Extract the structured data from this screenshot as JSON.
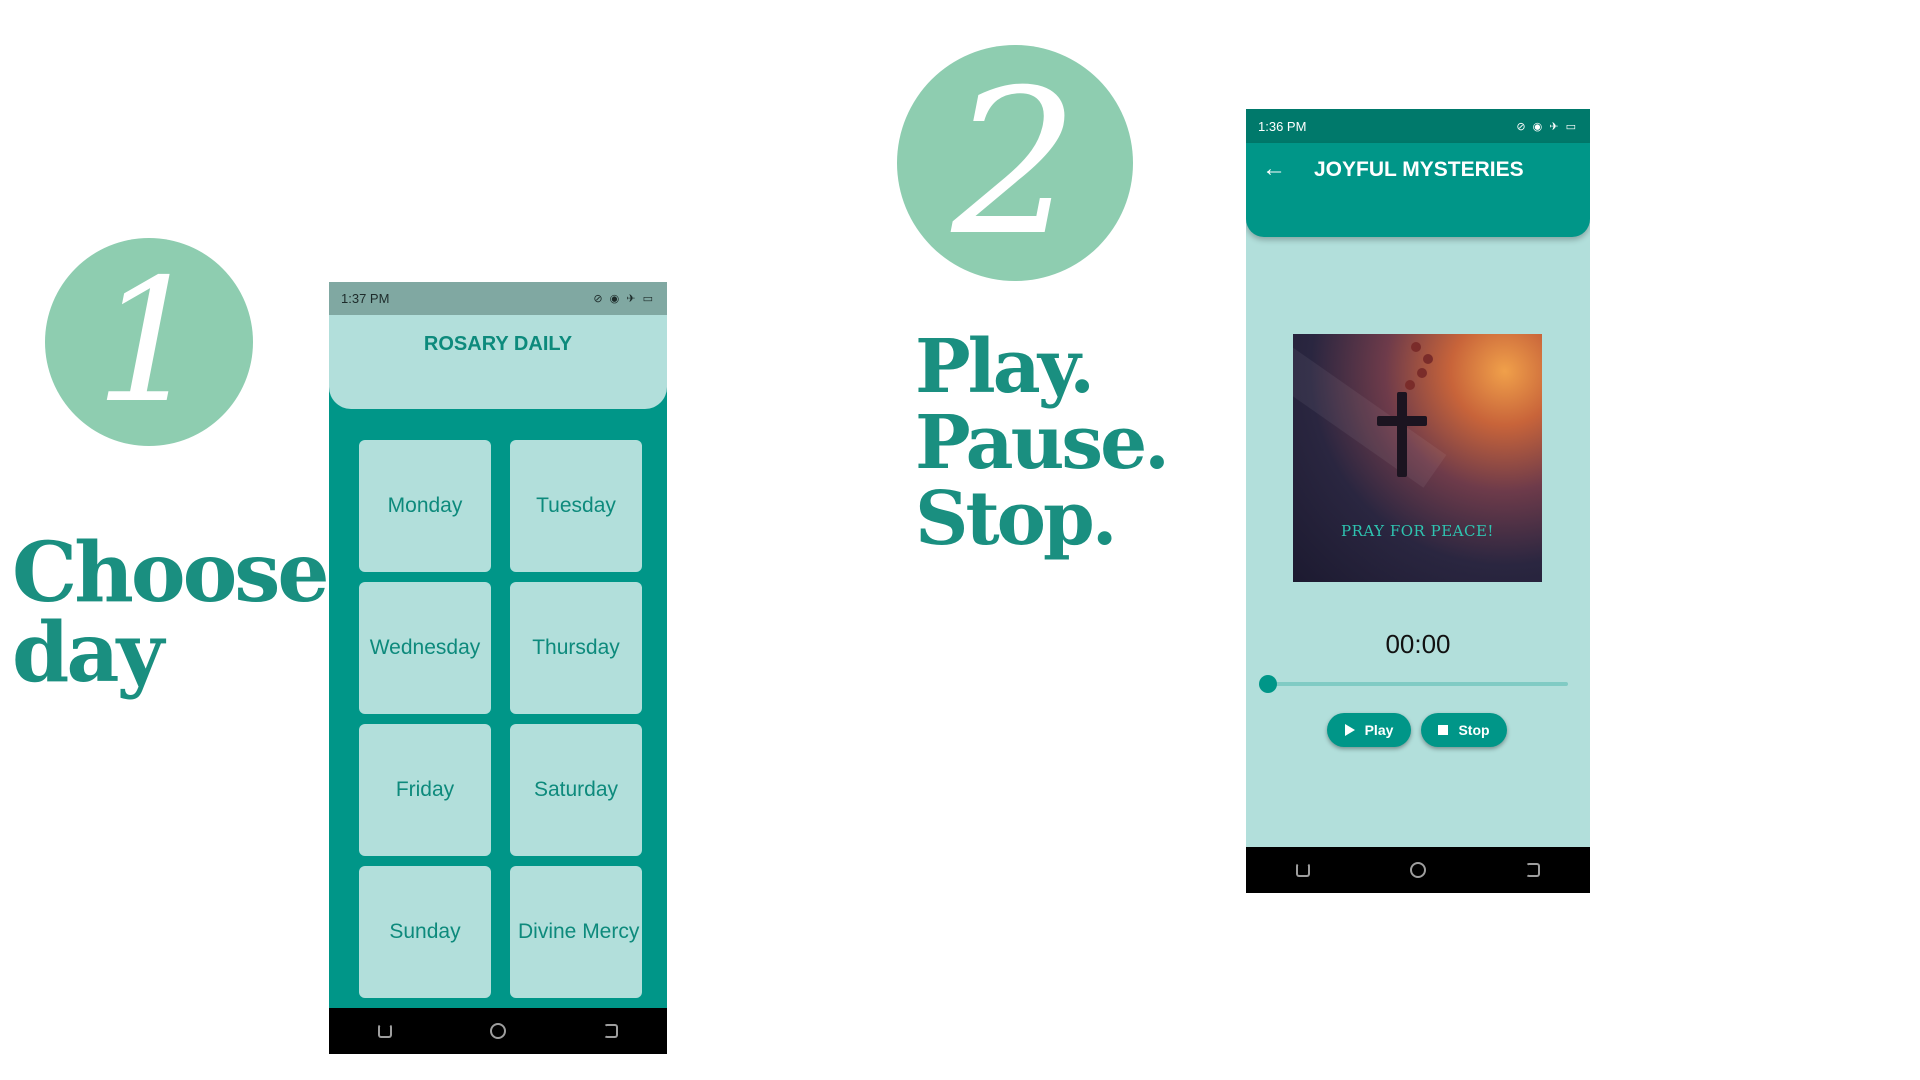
{
  "step1": {
    "number": "1",
    "headline": [
      "Choose",
      "day"
    ]
  },
  "step2": {
    "number": "2",
    "headline": [
      "Play.",
      "Pause.",
      "Stop."
    ]
  },
  "phone1": {
    "status_time": "1:37 PM",
    "app_title": "ROSARY DAILY",
    "days": [
      "Monday",
      "Tuesday",
      "Wednesday",
      "Thursday",
      "Friday",
      "Saturday",
      "Sunday",
      "Divine Mercy"
    ]
  },
  "phone2": {
    "status_time": "1:36 PM",
    "app_title": "JOYFUL MYSTERIES",
    "artwork_text": "PRAY FOR PEACE!",
    "time": "00:00",
    "progress": 0,
    "play_label": "Play",
    "stop_label": "Stop"
  },
  "colors": {
    "accent": "#009688",
    "light": "#b2dfdb",
    "badge": "#8ecdb0",
    "headline": "#1a8f80"
  }
}
